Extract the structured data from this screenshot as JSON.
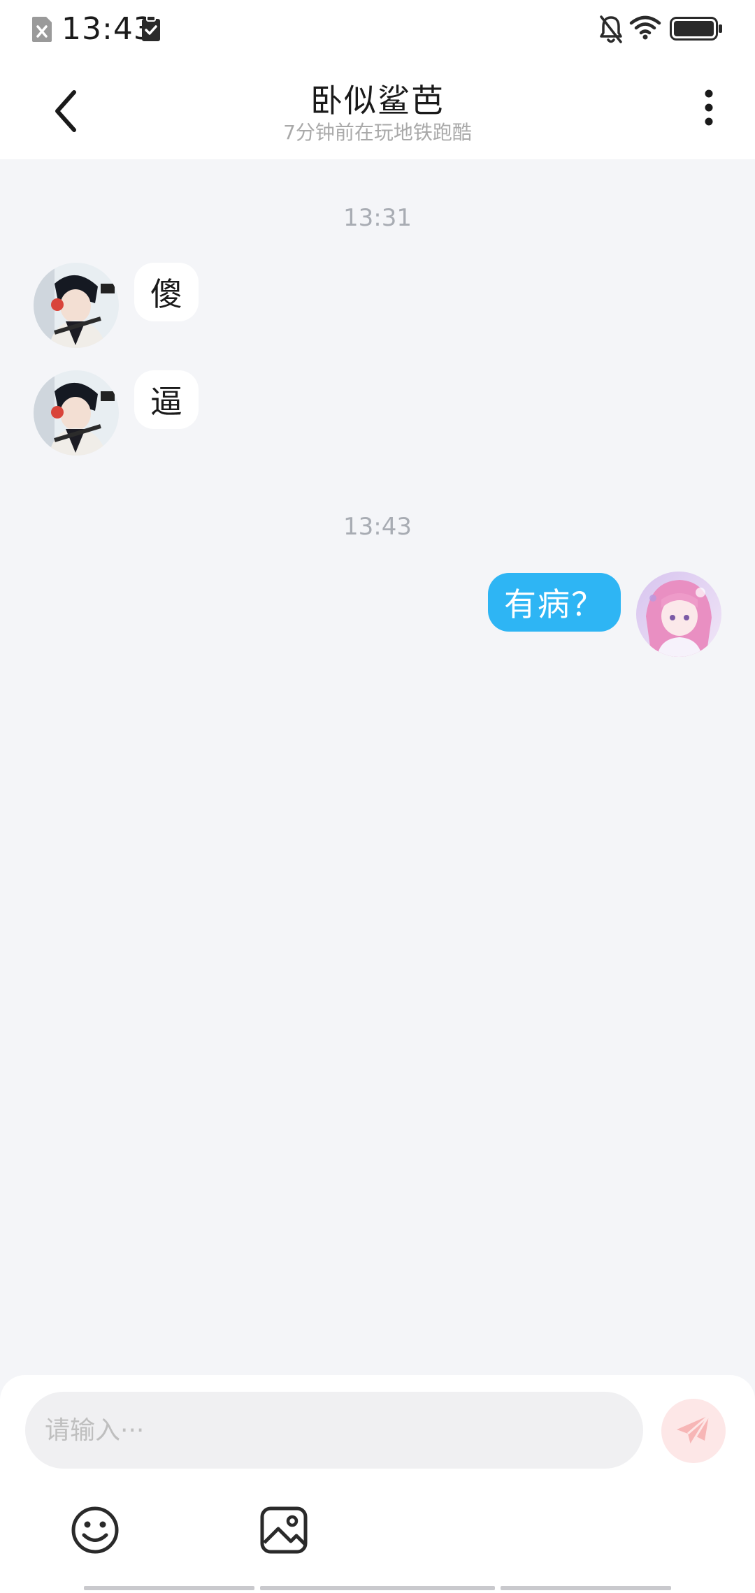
{
  "status_bar": {
    "time": "13:43"
  },
  "header": {
    "title": "卧似鲨芭",
    "subtitle": "7分钟前在玩地铁跑酷"
  },
  "chat": {
    "groups": [
      {
        "timestamp": "13:31",
        "messages": [
          {
            "side": "left",
            "text": "傻"
          },
          {
            "side": "left",
            "text": "逼"
          }
        ]
      },
      {
        "timestamp": "13:43",
        "messages": [
          {
            "side": "right",
            "text": "有病？"
          }
        ]
      }
    ]
  },
  "input": {
    "placeholder": "请输入···"
  },
  "colors": {
    "outgoing_bubble": "#2eb5f4",
    "incoming_bubble": "#ffffff",
    "background": "#f4f5f8",
    "send_button": "#fde7e7",
    "send_icon": "#f7b6b6"
  },
  "icons": {
    "back": "back-arrow-icon",
    "more": "more-vertical-icon",
    "emoji": "emoji-icon",
    "image": "image-icon",
    "send": "paper-plane-icon",
    "sim": "sim-card-icon",
    "clipboard": "clipboard-icon",
    "bell_off": "bell-off-icon",
    "wifi": "wifi-icon",
    "battery": "battery-icon"
  }
}
